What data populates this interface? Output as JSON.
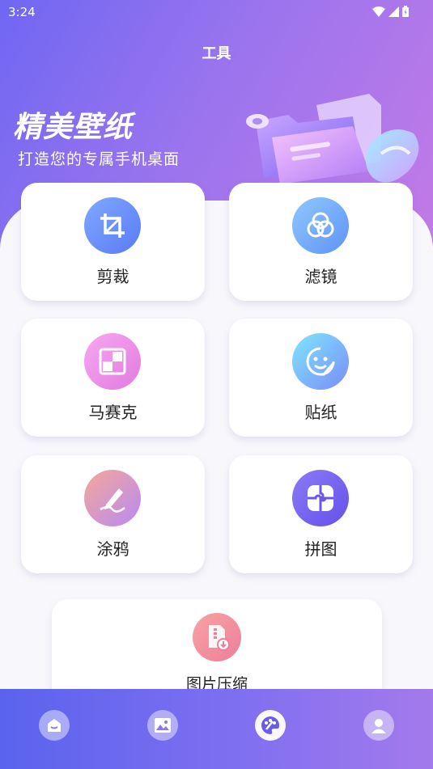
{
  "status_bar": {
    "time": "3:24"
  },
  "header": {
    "title": "工具"
  },
  "banner": {
    "title": "精美壁纸",
    "subtitle": "打造您的专属手机桌面"
  },
  "tools": [
    {
      "label": "剪裁",
      "icon": "crop-icon"
    },
    {
      "label": "滤镜",
      "icon": "filter-icon"
    },
    {
      "label": "马赛克",
      "icon": "mosaic-icon"
    },
    {
      "label": "贴纸",
      "icon": "sticker-icon"
    },
    {
      "label": "涂鸦",
      "icon": "doodle-icon"
    },
    {
      "label": "拼图",
      "icon": "puzzle-icon"
    },
    {
      "label": "图片压缩",
      "icon": "compress-icon"
    }
  ],
  "bottom_nav": [
    {
      "name": "home",
      "icon": "home-icon"
    },
    {
      "name": "wallpaper",
      "icon": "image-icon"
    },
    {
      "name": "tools",
      "icon": "palette-icon",
      "active": true
    },
    {
      "name": "profile",
      "icon": "user-icon"
    }
  ],
  "colors": {
    "header_gradient_start": "#6f67f2",
    "header_gradient_end": "#c47ae6",
    "nav_gradient_start": "#5a63ee",
    "nav_gradient_end": "#a47aec"
  }
}
